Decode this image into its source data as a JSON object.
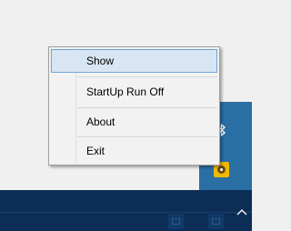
{
  "context_menu": {
    "items": [
      {
        "label": "Show",
        "highlighted": true
      },
      {
        "label": "StartUp Run Off",
        "highlighted": false
      },
      {
        "label": "About",
        "highlighted": false
      },
      {
        "label": "Exit",
        "highlighted": false
      }
    ]
  },
  "tray": {
    "icons": [
      "bluetooth-icon",
      "app-tray-icon"
    ]
  },
  "taskbar": {
    "icons": [
      "taskbar-app-icon",
      "taskbar-app-icon",
      "show-hidden-icons-chevron-icon"
    ]
  },
  "colors": {
    "accent": "#6fa4d8",
    "highlight": "#d8e6f3",
    "taskbar": "#0c2e56",
    "tray_panel": "#2a6fa4"
  }
}
